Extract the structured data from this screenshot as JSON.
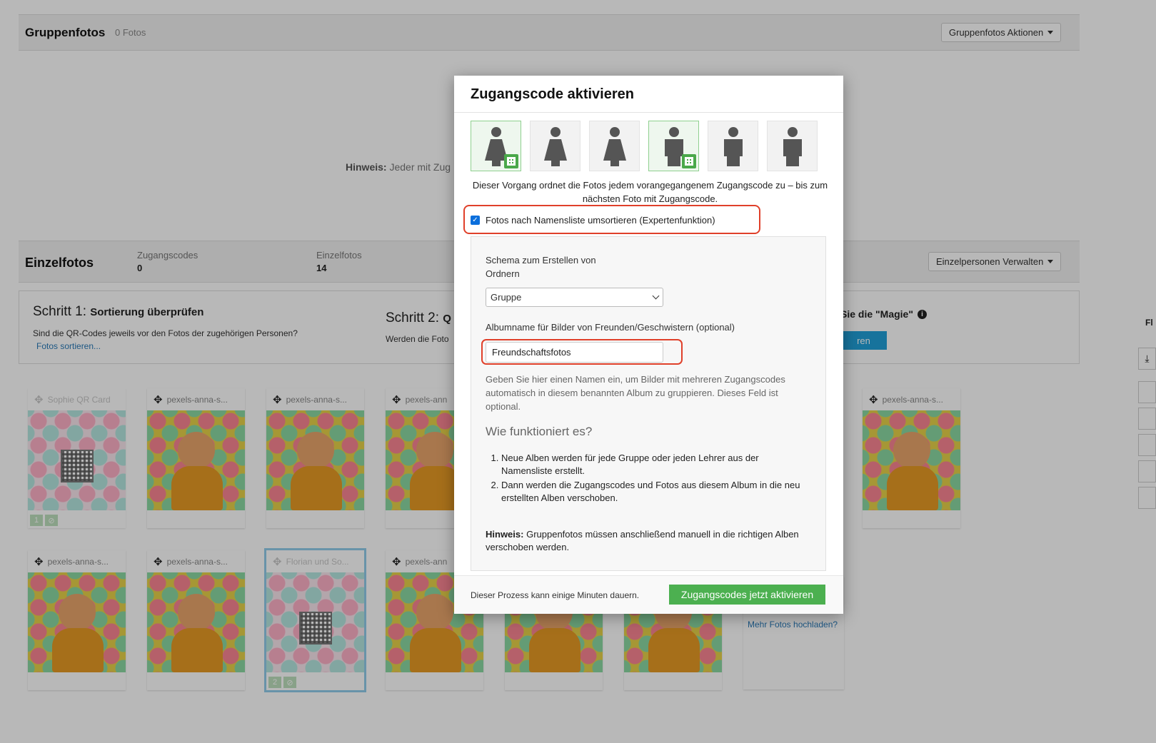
{
  "group": {
    "title": "Gruppenfotos",
    "count": "0 Fotos",
    "actions_label": "Gruppenfotos Aktionen",
    "hint_bold": "Hinweis:",
    "hint_text": "Jeder mit Zug"
  },
  "einzel": {
    "title": "Einzelfotos",
    "stat1_label": "Zugangscodes",
    "stat1_value": "0",
    "stat2_label": "Einzelfotos",
    "stat2_value": "14",
    "manage_label": "Einzelpersonen Verwalten"
  },
  "steps": {
    "step1_prefix": "Schritt 1:",
    "step1_title": "Sortierung überprüfen",
    "step1_text": "Sind die QR-Codes jeweils vor den Fotos der zugehörigen Personen?",
    "step1_link": "Fotos sortieren...",
    "step2_prefix": "Schritt 2:",
    "step2_title_partial": "Q",
    "step2_text": "Werden die Foto",
    "step3_title": "Sie die \"Magie\"",
    "step3_btn": "ren"
  },
  "cards": [
    {
      "label": "Sophie QR Card"
    },
    {
      "label": "pexels-anna-s..."
    },
    {
      "label": "pexels-anna-s..."
    },
    {
      "label": "pexels-ann"
    },
    {
      "label": "pexels-anna-s..."
    },
    {
      "label": "pexels-anna-s..."
    },
    {
      "label": "pexels-anna-s..."
    },
    {
      "label": "Florian und So..."
    },
    {
      "label": "pexels-ann"
    }
  ],
  "qr_badges": [
    "1",
    "2"
  ],
  "upload": {
    "link": "Mehr Fotos hochladen?"
  },
  "right": {
    "label": "Fl"
  },
  "modal": {
    "title": "Zugangscode aktivieren",
    "description": "Dieser Vorgang ordnet die Fotos jedem vorangegangenem Zugangscode zu – bis zum nächsten Foto mit Zugangscode.",
    "checkbox_label": "Fotos nach Namensliste umsortieren (Expertenfunktion)",
    "schema_label": "Schema zum Erstellen von Ordnern",
    "schema_value": "Gruppe",
    "album_label": "Albumname für Bilder von Freunden/Geschwistern (optional)",
    "album_value": "Freundschaftsfotos",
    "help_text": "Geben Sie hier einen Namen ein, um Bilder mit mehreren Zugangscodes automatisch in diesem benannten Album zu gruppieren. Dieses Feld ist optional.",
    "how_title": "Wie funktioniert es?",
    "how_steps": [
      "Neue Alben werden für jede Gruppe oder jeden Lehrer aus der Namensliste erstellt.",
      "Dann werden die Zugangscodes und Fotos aus diesem Album in die neu erstellten Alben verschoben."
    ],
    "hint_bold": "Hinweis:",
    "hint_text": "Gruppenfotos müssen anschließend manuell in die richtigen Alben verschoben werden.",
    "footer_text": "Dieser Prozess kann einige Minuten dauern.",
    "submit_label": "Zugangscodes jetzt aktivieren"
  }
}
